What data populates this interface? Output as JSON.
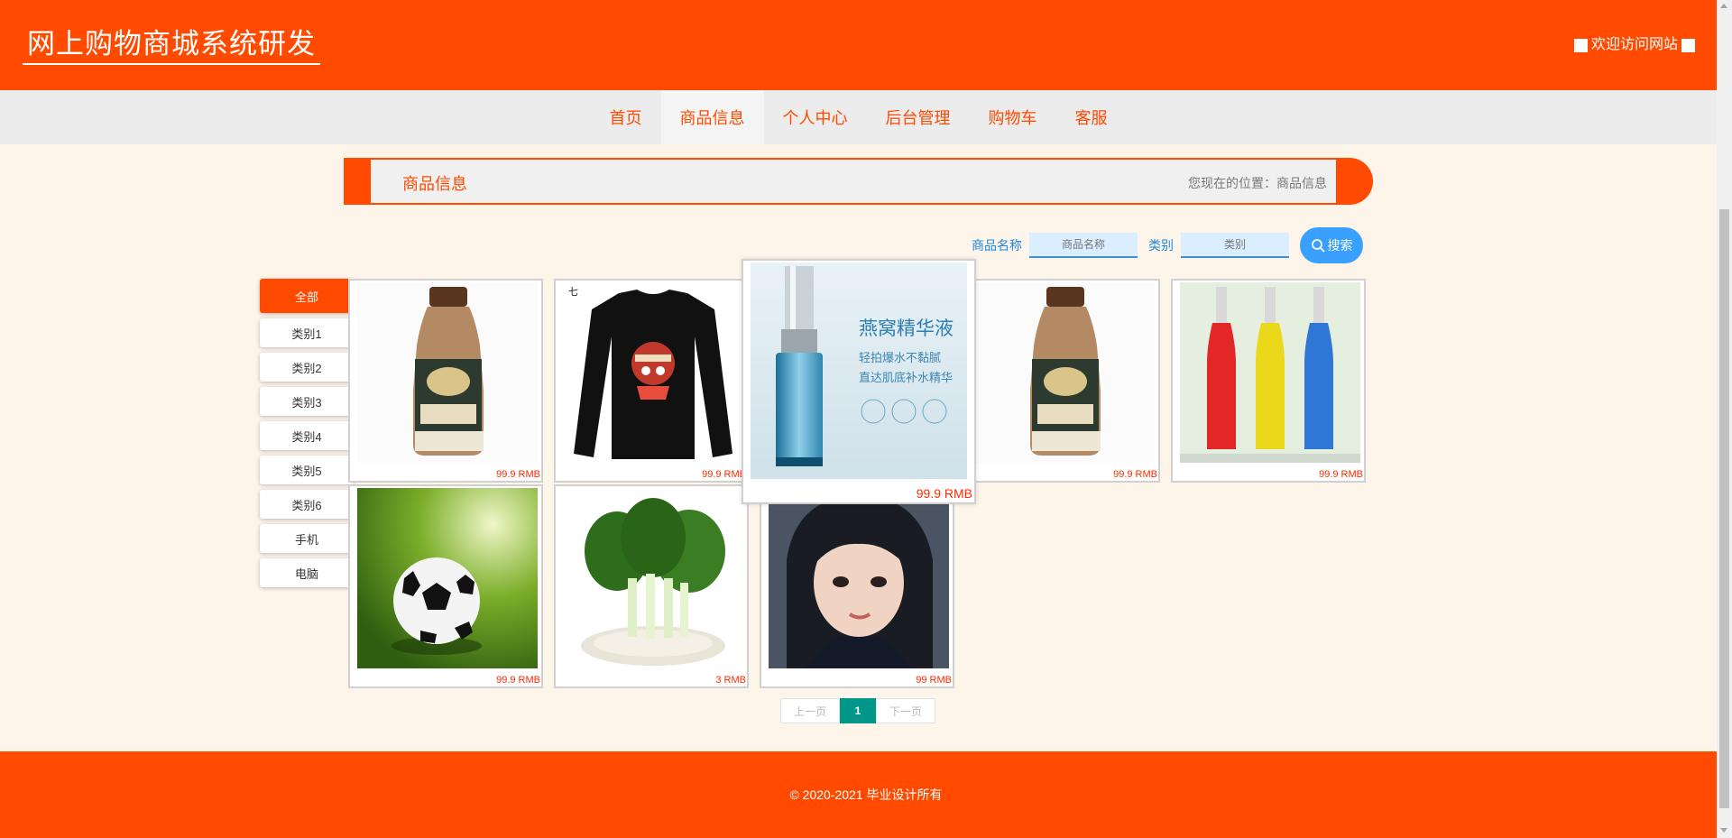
{
  "header": {
    "site_title": "网上购物商城系统研发",
    "welcome": "欢迎访问网站"
  },
  "nav": [
    {
      "label": "首页",
      "active": false
    },
    {
      "label": "商品信息",
      "active": true
    },
    {
      "label": "个人中心",
      "active": false
    },
    {
      "label": "后台管理",
      "active": false
    },
    {
      "label": "购物车",
      "active": false
    },
    {
      "label": "客服",
      "active": false
    }
  ],
  "banner": {
    "title": "商品信息",
    "breadcrumb": "您现在的位置：商品信息"
  },
  "search": {
    "name_label": "商品名称",
    "name_placeholder": "商品名称",
    "category_label": "类别",
    "category_placeholder": "类别",
    "button_label": "搜索"
  },
  "categories": [
    "全部",
    "类别1",
    "类别2",
    "类别3",
    "类别4",
    "类别5",
    "类别6",
    "手机",
    "电脑"
  ],
  "products": [
    {
      "image": "milk-tea-bottle",
      "price": "99.9 RMB"
    },
    {
      "image": "black-longsleeve-tshirt",
      "price": "99.9 RMB"
    },
    {
      "image": "essence-serum-bottle",
      "price": "99.9 RMB",
      "hovered": true,
      "image_text": [
        "燕窝精华液",
        "轻拍爆水不黏腻",
        "直达肌底补水精华"
      ]
    },
    {
      "image": "milk-tea-bottle",
      "price": "99.9 RMB"
    },
    {
      "image": "three-color-bottles",
      "price": "99.9 RMB"
    },
    {
      "image": "soccer-ball",
      "price": "99.9 RMB"
    },
    {
      "image": "green-vegetables",
      "price": "3 RMB"
    },
    {
      "image": "girl-portrait",
      "price": "99 RMB"
    }
  ],
  "pagination": {
    "prev": "上一页",
    "current": "1",
    "next": "下一页"
  },
  "footer": {
    "copyright": "© 2020-2021 毕业设计所有"
  },
  "colors": {
    "brand": "#ff4a00",
    "page_bg": "#fdf4ea",
    "search_blue": "#3aa0ff",
    "pager_active": "#009688",
    "price": "#ff2a00"
  }
}
